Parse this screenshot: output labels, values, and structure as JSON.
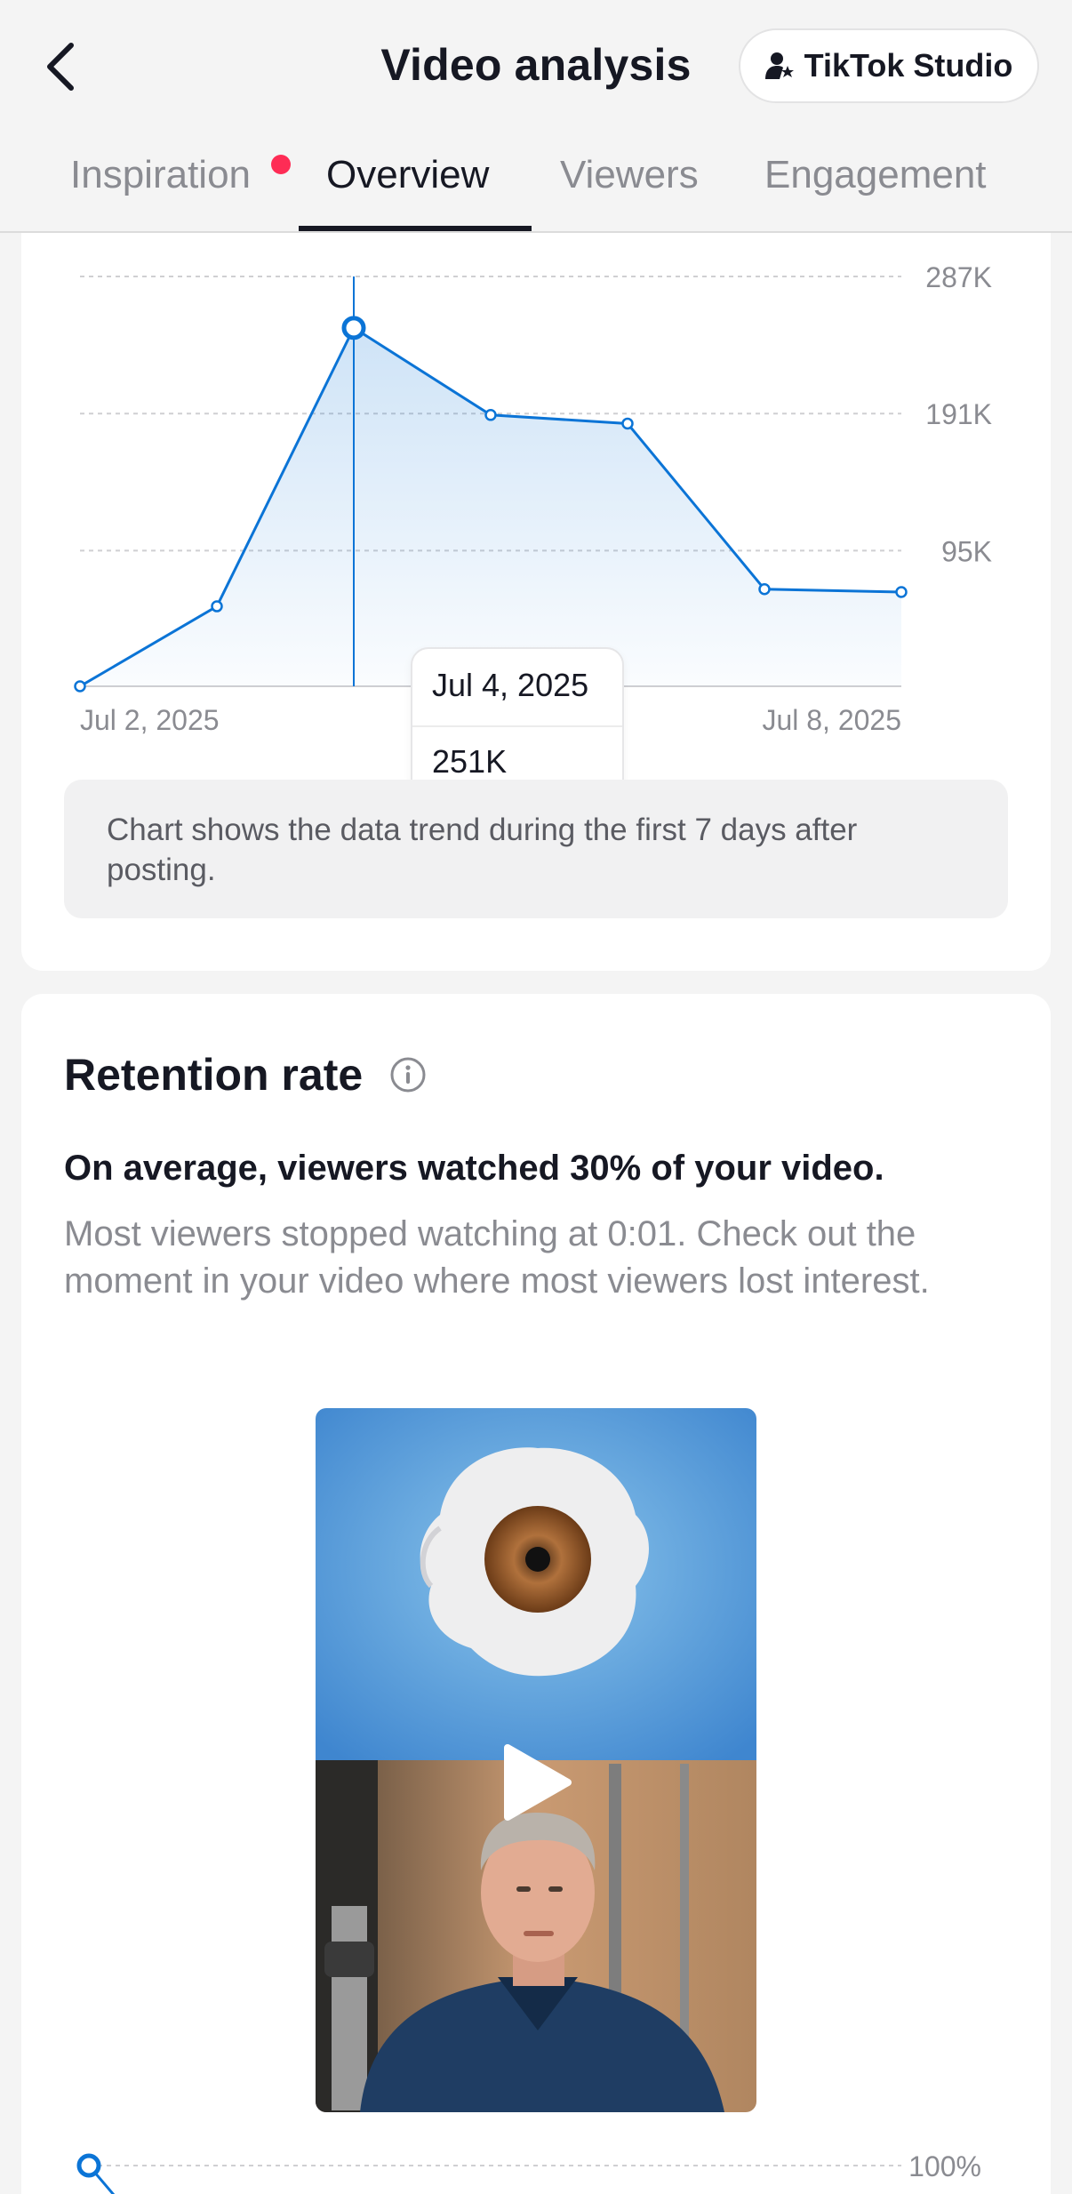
{
  "header": {
    "title": "Video analysis",
    "studio_button": "TikTok Studio"
  },
  "tabs": [
    {
      "label": "Inspiration",
      "has_dot": true
    },
    {
      "label": "Overview",
      "active": true
    },
    {
      "label": "Viewers"
    },
    {
      "label": "Engagement"
    }
  ],
  "chart_data": [
    {
      "type": "area",
      "x": [
        "Jul 2, 2025",
        "Jul 3, 2025",
        "Jul 4, 2025",
        "Jul 5, 2025",
        "Jul 6, 2025",
        "Jul 7, 2025",
        "Jul 8, 2025"
      ],
      "values": [
        0,
        56000,
        251000,
        190000,
        184000,
        68000,
        66000
      ],
      "x_tick_labels": [
        "Jul 2, 2025",
        "Jul 8, 2025"
      ],
      "y_tick_labels": [
        "287K",
        "191K",
        "95K"
      ],
      "y_ticks": [
        287000,
        191000,
        95000
      ],
      "ylim": [
        0,
        287000
      ],
      "grid": true,
      "selected_index": 2,
      "tooltip": {
        "date": "Jul 4, 2025",
        "value": "251K"
      },
      "color": "#0b74d6"
    },
    {
      "type": "line",
      "y_tick_labels": [
        "100%"
      ],
      "visible_start_value": 100
    }
  ],
  "chart_note": "Chart shows the data trend during the first 7 days after posting.",
  "retention": {
    "title": "Retention rate",
    "summary": "On average, viewers watched 30% of your video.",
    "description": "Most viewers stopped watching at 0:01. Check out the moment in your video where most viewers lost interest.",
    "y_top_label": "100%"
  },
  "colors": {
    "accent": "#0b74d6",
    "tab_dot": "#fe2c55"
  }
}
